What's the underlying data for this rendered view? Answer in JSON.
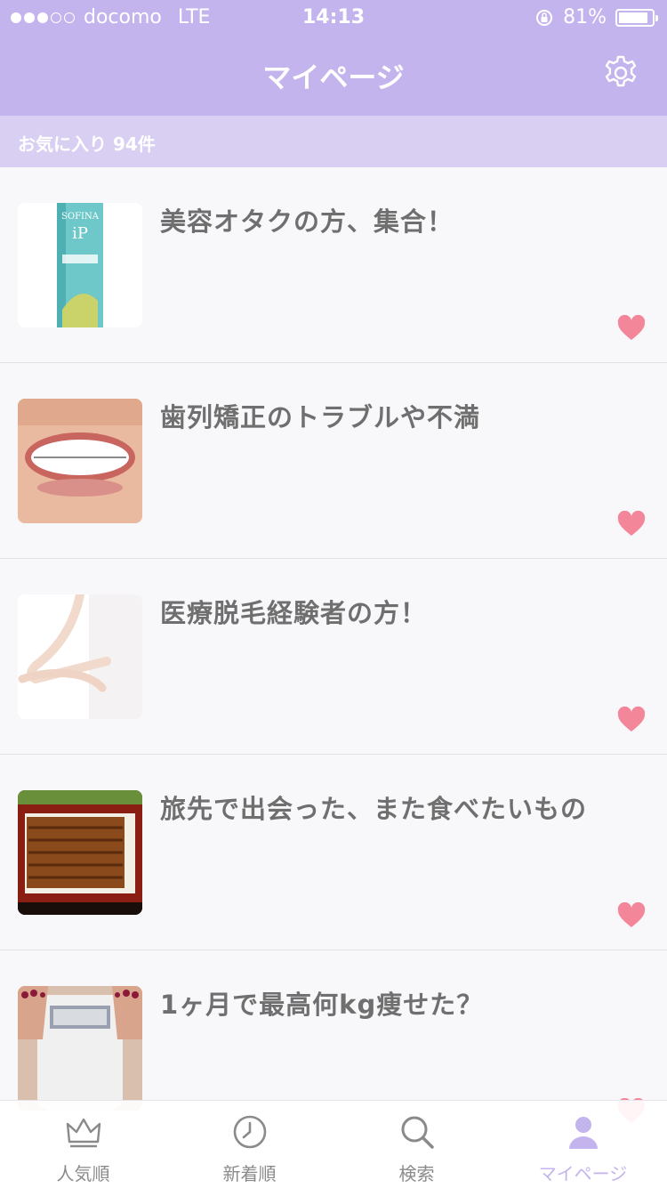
{
  "status_bar": {
    "carrier": "docomo",
    "network": "LTE",
    "time": "14:13",
    "battery": "81%",
    "battery_level": 0.81,
    "signal_bars_filled": 3,
    "signal_bars_total": 5
  },
  "header": {
    "title": "マイページ",
    "settings_icon": "gear-icon"
  },
  "favorites_bar": {
    "label": "お気に入り 94件"
  },
  "topics": [
    {
      "title": "美容オタクの方、集合！",
      "favorited": true
    },
    {
      "title": "歯列矯正のトラブルや不満",
      "favorited": true
    },
    {
      "title": "医療脱毛経験者の方！",
      "favorited": true
    },
    {
      "title": "旅先で出会った、また食べたいもの",
      "favorited": true
    },
    {
      "title": "1ヶ月で最高何kg痩せた？",
      "favorited": true
    }
  ],
  "tabs": [
    {
      "label": "人気順",
      "icon": "crown-icon",
      "active": false
    },
    {
      "label": "新着順",
      "icon": "clock-icon",
      "active": false
    },
    {
      "label": "検索",
      "icon": "search-icon",
      "active": false
    },
    {
      "label": "マイページ",
      "icon": "user-icon",
      "active": true
    }
  ],
  "colors": {
    "accent": "#c4b4ee",
    "favorites_bar": "#d8cff2",
    "heart": "#f4869a",
    "title_text": "#6f6f6f"
  }
}
